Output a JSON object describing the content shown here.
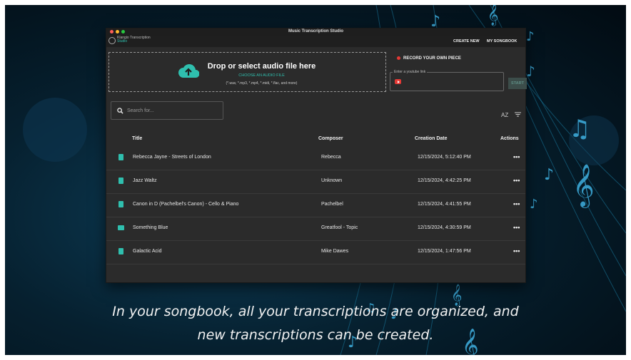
{
  "window": {
    "title": "Music Transcription Studio"
  },
  "brand": {
    "line1": "Klangio Transcription",
    "line2": "Studio"
  },
  "nav": {
    "create_new": "CREATE NEW",
    "my_songbook": "MY SONGBOOK"
  },
  "dropzone": {
    "title": "Drop or select audio file here",
    "choose_label": "CHOOSE AN AUDIO FILE",
    "formats": "(*.wav, *.mp3, *.mp4, *.midi, *.flac, and more)"
  },
  "record": {
    "label": "RECORD YOUR OWN PIECE"
  },
  "youtube": {
    "label": "Enter a youtube link",
    "value": ""
  },
  "start_button": {
    "label": "START"
  },
  "search": {
    "placeholder": "Search for..."
  },
  "sort_icon": {
    "label": "AZ"
  },
  "table": {
    "headers": {
      "title": "Title",
      "composer": "Composer",
      "date": "Creation Date",
      "actions": "Actions"
    },
    "rows": [
      {
        "icon": "file-icon",
        "title": "Rebecca Jayne - Streets of London",
        "composer": "Rebecca",
        "date": "12/15/2024, 5:12:40 PM",
        "actions": "•••"
      },
      {
        "icon": "file-icon",
        "title": "Jazz Waltz",
        "composer": "Unknown",
        "date": "12/15/2024, 4:42:25 PM",
        "actions": "•••"
      },
      {
        "icon": "file-icon",
        "title": "Canon in D (Pachelbel's Canon) - Cello & Piano",
        "composer": "Pachelbel",
        "date": "12/15/2024, 4:41:55 PM",
        "actions": "•••"
      },
      {
        "icon": "video-icon",
        "title": "Something Blue",
        "composer": "Greatfool - Topic",
        "date": "12/15/2024, 4:30:59 PM",
        "actions": "•••"
      },
      {
        "icon": "file-icon",
        "title": "Galactic Acid",
        "composer": "Mike Dawes",
        "date": "12/15/2024, 1:47:56 PM",
        "actions": "•••"
      }
    ]
  },
  "caption": {
    "line1": "In your songbook, all your transcriptions are organized, and",
    "line2": "new transcriptions can be created."
  },
  "colors": {
    "accent": "#2fbfae",
    "record": "#e53935",
    "window_bg": "#2b2b2b"
  }
}
